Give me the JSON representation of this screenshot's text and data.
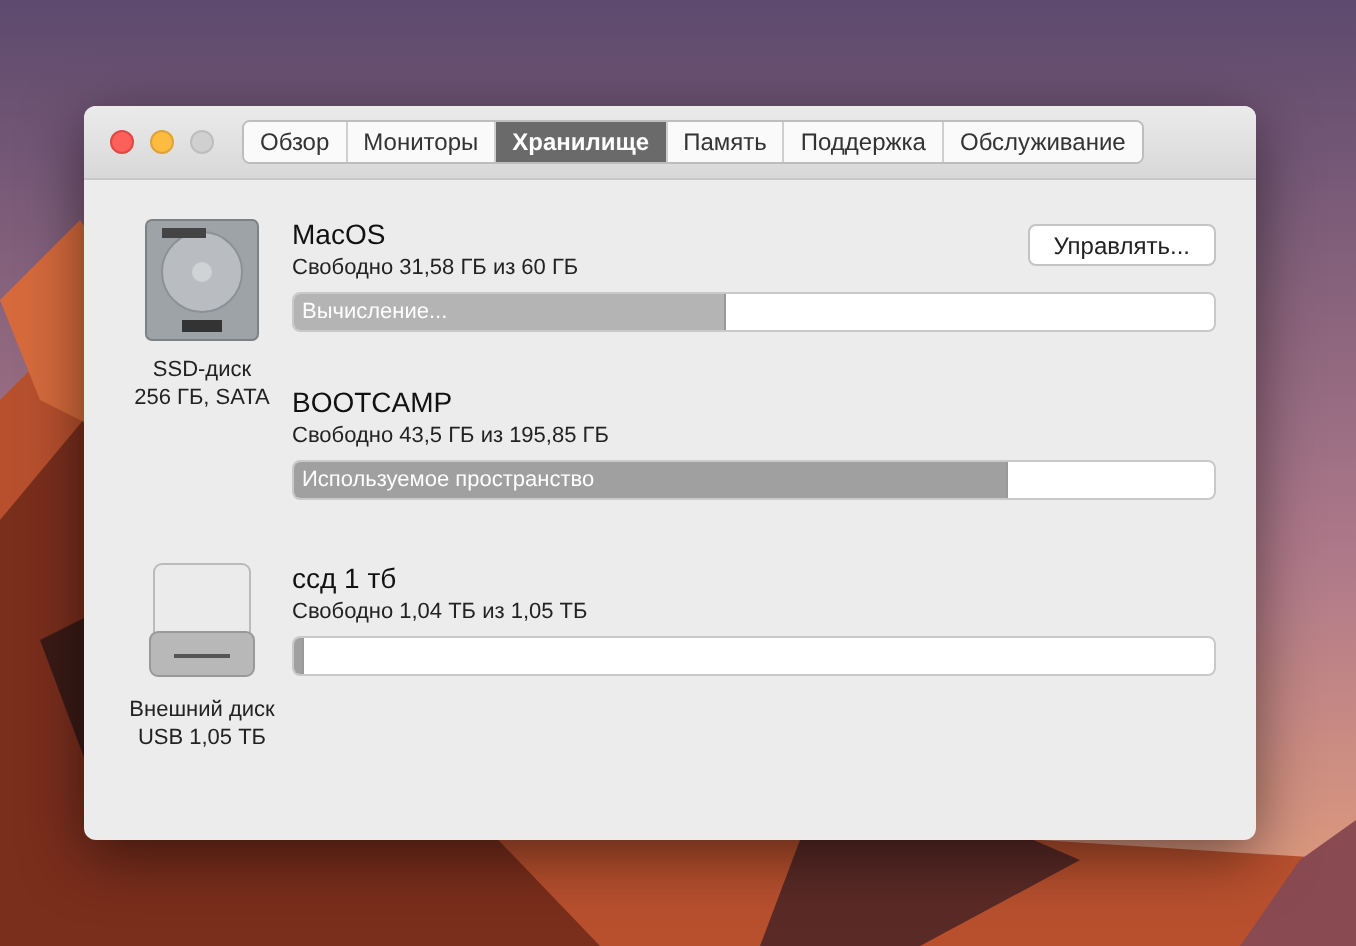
{
  "window_controls": [
    {
      "kind": "close",
      "disabled": false
    },
    {
      "kind": "minimize",
      "disabled": false
    },
    {
      "kind": "zoom",
      "disabled": true
    }
  ],
  "tabs": [
    {
      "label": "Обзор",
      "selected": false
    },
    {
      "label": "Мониторы",
      "selected": false
    },
    {
      "label": "Хранилище",
      "selected": true
    },
    {
      "label": "Память",
      "selected": false
    },
    {
      "label": "Поддержка",
      "selected": false
    },
    {
      "label": "Обслуживание",
      "selected": false
    }
  ],
  "disks": [
    {
      "kind": "internal",
      "label_lines": [
        "SSD-диск",
        "256 ГБ, SATA"
      ],
      "volumes": [
        {
          "name": "MacOS",
          "free": "Свободно 31,58 ГБ из 60 ГБ",
          "level": 0.47,
          "calculating": true,
          "bar_label": "Вычисление...",
          "button": "Управлять..."
        },
        {
          "name": "BOOTCAMP",
          "free": "Свободно 43,5 ГБ из 195,85 ГБ",
          "level": 0.775,
          "calculating": false,
          "bar_label": "Используемое пространство"
        }
      ]
    },
    {
      "kind": "external",
      "label_lines": [
        "Внешний диск",
        "USB 1,05 ТБ"
      ],
      "volumes": [
        {
          "name": "ссд 1 тб",
          "free": "Свободно 1,04 ТБ из 1,05 ТБ",
          "level": 0.01,
          "calculating": false
        }
      ]
    }
  ]
}
